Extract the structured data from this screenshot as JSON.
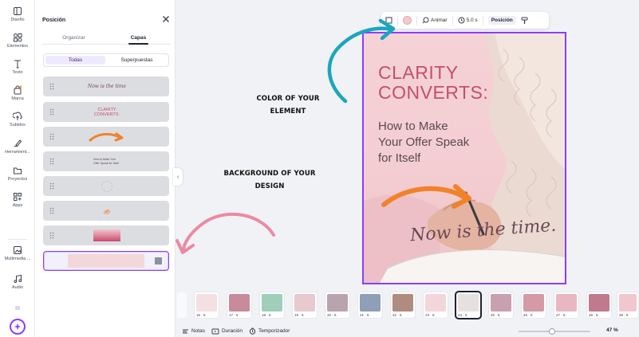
{
  "rail": {
    "items": [
      {
        "label": "Diseño",
        "icon": "layout-icon"
      },
      {
        "label": "Elementos",
        "icon": "shapes-icon"
      },
      {
        "label": "Texto",
        "icon": "text-icon"
      },
      {
        "label": "Marca",
        "icon": "brand-icon"
      },
      {
        "label": "Subidos",
        "icon": "upload-icon"
      },
      {
        "label": "Herramient...",
        "icon": "draw-icon"
      },
      {
        "label": "Proyectos",
        "icon": "folder-icon"
      },
      {
        "label": "Apps",
        "icon": "apps-icon"
      },
      {
        "label": "Multimedia ...",
        "icon": "photos-icon"
      },
      {
        "label": "Audio",
        "icon": "music-icon"
      }
    ]
  },
  "panel": {
    "title": "Posición",
    "tabs": [
      {
        "label": "Organizar"
      },
      {
        "label": "Capas"
      }
    ],
    "active_tab": 1,
    "filters": [
      {
        "label": "Todas"
      },
      {
        "label": "Superpuestas"
      }
    ],
    "active_filter": 0,
    "layers": [
      {
        "kind": "script",
        "text": "Now is the time"
      },
      {
        "kind": "heading",
        "text": "CLARITY CONVERTS:"
      },
      {
        "kind": "arrow",
        "text": ""
      },
      {
        "kind": "body",
        "text": "How to Make Your Offer Speak for Itself"
      },
      {
        "kind": "blank",
        "text": ""
      },
      {
        "kind": "image",
        "text": ""
      },
      {
        "kind": "gradient",
        "text": ""
      },
      {
        "kind": "background",
        "text": "",
        "selected": true
      }
    ]
  },
  "toolbar": {
    "animate_label": "Animar",
    "duration_label": "5.0 s",
    "position_label": "Posición",
    "swatch_color": "#f4c9cd"
  },
  "design": {
    "headline": "CLARITY CONVERTS:",
    "headline_line1": "CLARITY",
    "headline_line2": "CONVERTS:",
    "subhead_line1": "How to Make",
    "subhead_line2": "Your Offer Speak",
    "subhead_line3": "for Itself",
    "script": "Now is the time.",
    "headline_color": "#c2506a",
    "arrow_color": "#f0822a",
    "selection_color": "#8b3dff"
  },
  "annotations": {
    "element_line1": "COLOR OF YOUR",
    "element_line2": "ELEMENT",
    "background_line1": "BACKGROUND OF YOUR",
    "background_line2": "DESIGN",
    "teal_arrow_color": "#1aa6bd",
    "pink_arrow_color": "#ea8aa5"
  },
  "filmstrip": {
    "frames": [
      {
        "label": "16 · 5",
        "color": "#f4dfe3"
      },
      {
        "label": "17 · 5",
        "color": "#c98a9c"
      },
      {
        "label": "18 · 5",
        "color": "#9fcfb8"
      },
      {
        "label": "19 · 5",
        "color": "#e7c9ce"
      },
      {
        "label": "20 · 5",
        "color": "#b9a4ad"
      },
      {
        "label": "21 · 5",
        "color": "#8f9fb8"
      },
      {
        "label": "22 · 5",
        "color": "#b08c7e"
      },
      {
        "label": "23 · 5",
        "color": "#f2d6da"
      },
      {
        "label": "24 · 5",
        "color": "#e6e1df"
      },
      {
        "label": "25 · 5",
        "color": "#c9a0b0"
      },
      {
        "label": "26 · 5",
        "color": "#d49aa6"
      },
      {
        "label": "27 · 5",
        "color": "#e9b7c2"
      },
      {
        "label": "28 · 5",
        "color": "#c07a8e"
      },
      {
        "label": "29 · 5",
        "color": "#f1c7cf"
      }
    ],
    "current_index": 8
  },
  "bottom": {
    "notes_label": "Notas",
    "duration_label": "Duración",
    "timer_label": "Temporizador",
    "zoom_value": "47 %",
    "zoom_fraction": 0.47
  }
}
